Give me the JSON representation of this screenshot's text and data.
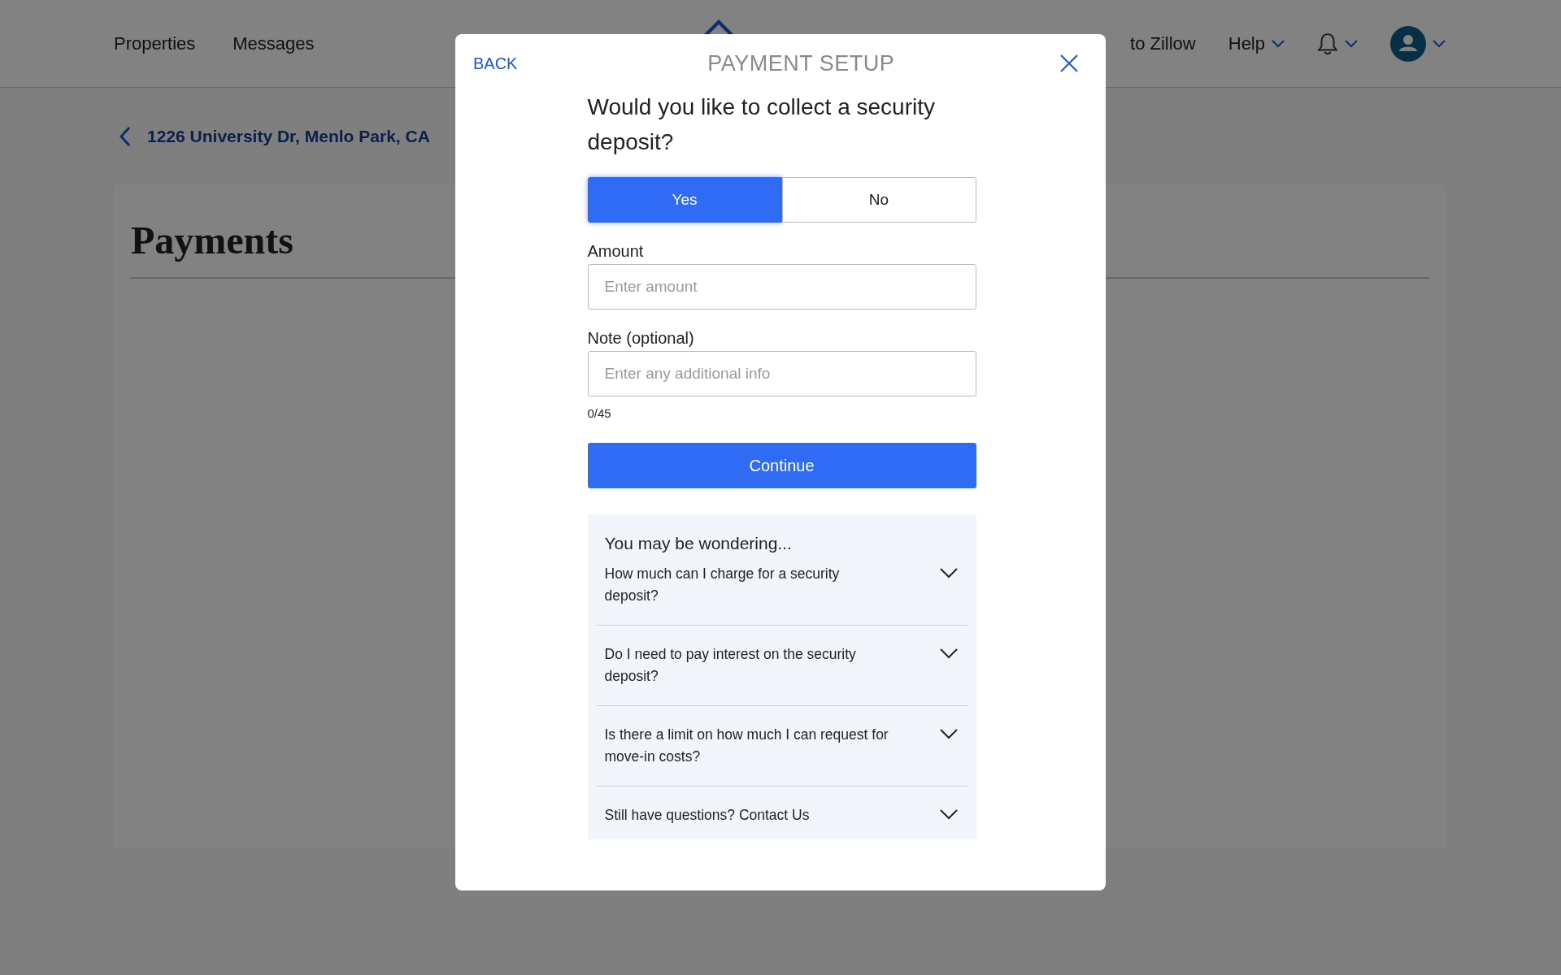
{
  "header": {
    "nav": [
      {
        "label": "Properties"
      },
      {
        "label": "Messages"
      }
    ],
    "back_link": "to Zillow",
    "help": "Help"
  },
  "breadcrumb": "1226 University Dr, Menlo Park, CA",
  "page_title": "Payments",
  "modal": {
    "back": "BACK",
    "title": "PAYMENT SETUP",
    "question": "Would you like to collect a security deposit?",
    "options": [
      {
        "label": "Yes",
        "selected": true
      },
      {
        "label": "No",
        "selected": false
      }
    ],
    "fields": [
      {
        "label": "Amount",
        "placeholder": "Enter amount"
      },
      {
        "label": "Note (optional)",
        "placeholder": "Enter any additional info",
        "counter": "0/45"
      }
    ],
    "continue": "Continue",
    "faq": {
      "title": "You may be wondering...",
      "items": [
        {
          "question": "How much can I charge for a security deposit?"
        },
        {
          "question": "Do I need to pay interest on the security deposit?"
        },
        {
          "question": "Is there a limit on how much I can request for move-in costs?"
        },
        {
          "question": "Still have questions? Contact Us"
        }
      ]
    }
  }
}
